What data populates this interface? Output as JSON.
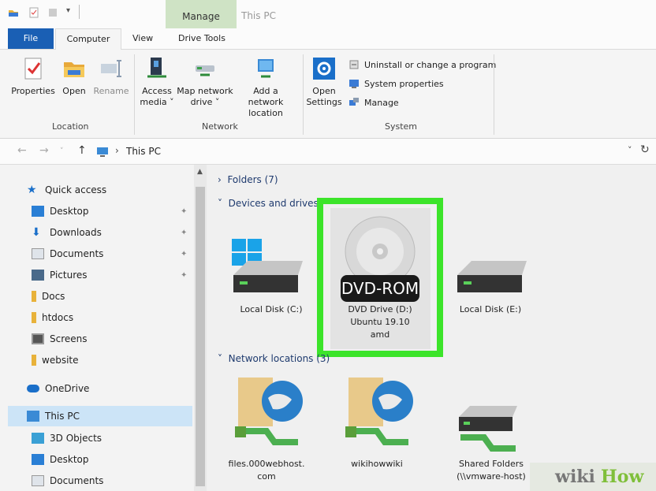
{
  "window": {
    "title": "This PC",
    "context_tab": "Manage"
  },
  "tabs": [
    "File",
    "Computer",
    "View",
    "Drive Tools"
  ],
  "ribbon": {
    "location": {
      "label": "Location",
      "buttons": [
        {
          "label": "Properties",
          "icon": "properties-icon"
        },
        {
          "label": "Open",
          "icon": "folder-open-icon"
        },
        {
          "label": "Rename",
          "icon": "rename-icon",
          "disabled": true
        }
      ]
    },
    "network": {
      "label": "Network",
      "buttons": [
        {
          "line1": "Access",
          "line2": "media ˅",
          "icon": "access-media-icon"
        },
        {
          "line1": "Map network",
          "line2": "drive ˅",
          "icon": "map-drive-icon"
        },
        {
          "line1": "Add a network",
          "line2": "location",
          "icon": "network-location-icon"
        }
      ]
    },
    "system": {
      "label": "System",
      "open_settings": {
        "line1": "Open",
        "line2": "Settings",
        "icon": "gear-icon"
      },
      "items": [
        {
          "label": "Uninstall or change a program",
          "icon": "uninstall-icon"
        },
        {
          "label": "System properties",
          "icon": "system-properties-icon"
        },
        {
          "label": "Manage",
          "icon": "manage-icon"
        }
      ]
    }
  },
  "address": {
    "path": "This PC",
    "separator": "›"
  },
  "nav": {
    "quick_access": "Quick access",
    "items": [
      {
        "label": "Desktop",
        "pinned": true
      },
      {
        "label": "Downloads",
        "pinned": true
      },
      {
        "label": "Documents",
        "pinned": true
      },
      {
        "label": "Pictures",
        "pinned": true
      },
      {
        "label": "Docs",
        "pinned": false
      },
      {
        "label": "htdocs",
        "pinned": false
      },
      {
        "label": "Screens",
        "pinned": false
      },
      {
        "label": "website",
        "pinned": false
      }
    ],
    "onedrive": "OneDrive",
    "this_pc": "This PC",
    "this_pc_items": [
      "3D Objects",
      "Desktop",
      "Documents"
    ]
  },
  "content": {
    "folders_header": "Folders (7)",
    "devices_header": "Devices and drives",
    "network_header": "Network locations (3)",
    "drives": [
      {
        "label": "Local Disk (C:)"
      },
      {
        "line1": "DVD Drive (D:)",
        "line2": "Ubuntu 19.10",
        "line3": "amd",
        "badge": "DVD-ROM"
      },
      {
        "label": "Local Disk (E:)"
      }
    ],
    "network_locations": [
      {
        "line1": "files.000webhost.",
        "line2": "com"
      },
      {
        "line1": "wikihowwiki",
        "line2": ""
      },
      {
        "line1": "Shared Folders",
        "line2": "(\\\\vmware-host)"
      }
    ]
  },
  "watermark": {
    "wiki": "wiki",
    "how": "How"
  },
  "colors": {
    "highlight": "#3ce42a",
    "file_tab": "#1a5fb4",
    "selection": "#cce4f7"
  }
}
